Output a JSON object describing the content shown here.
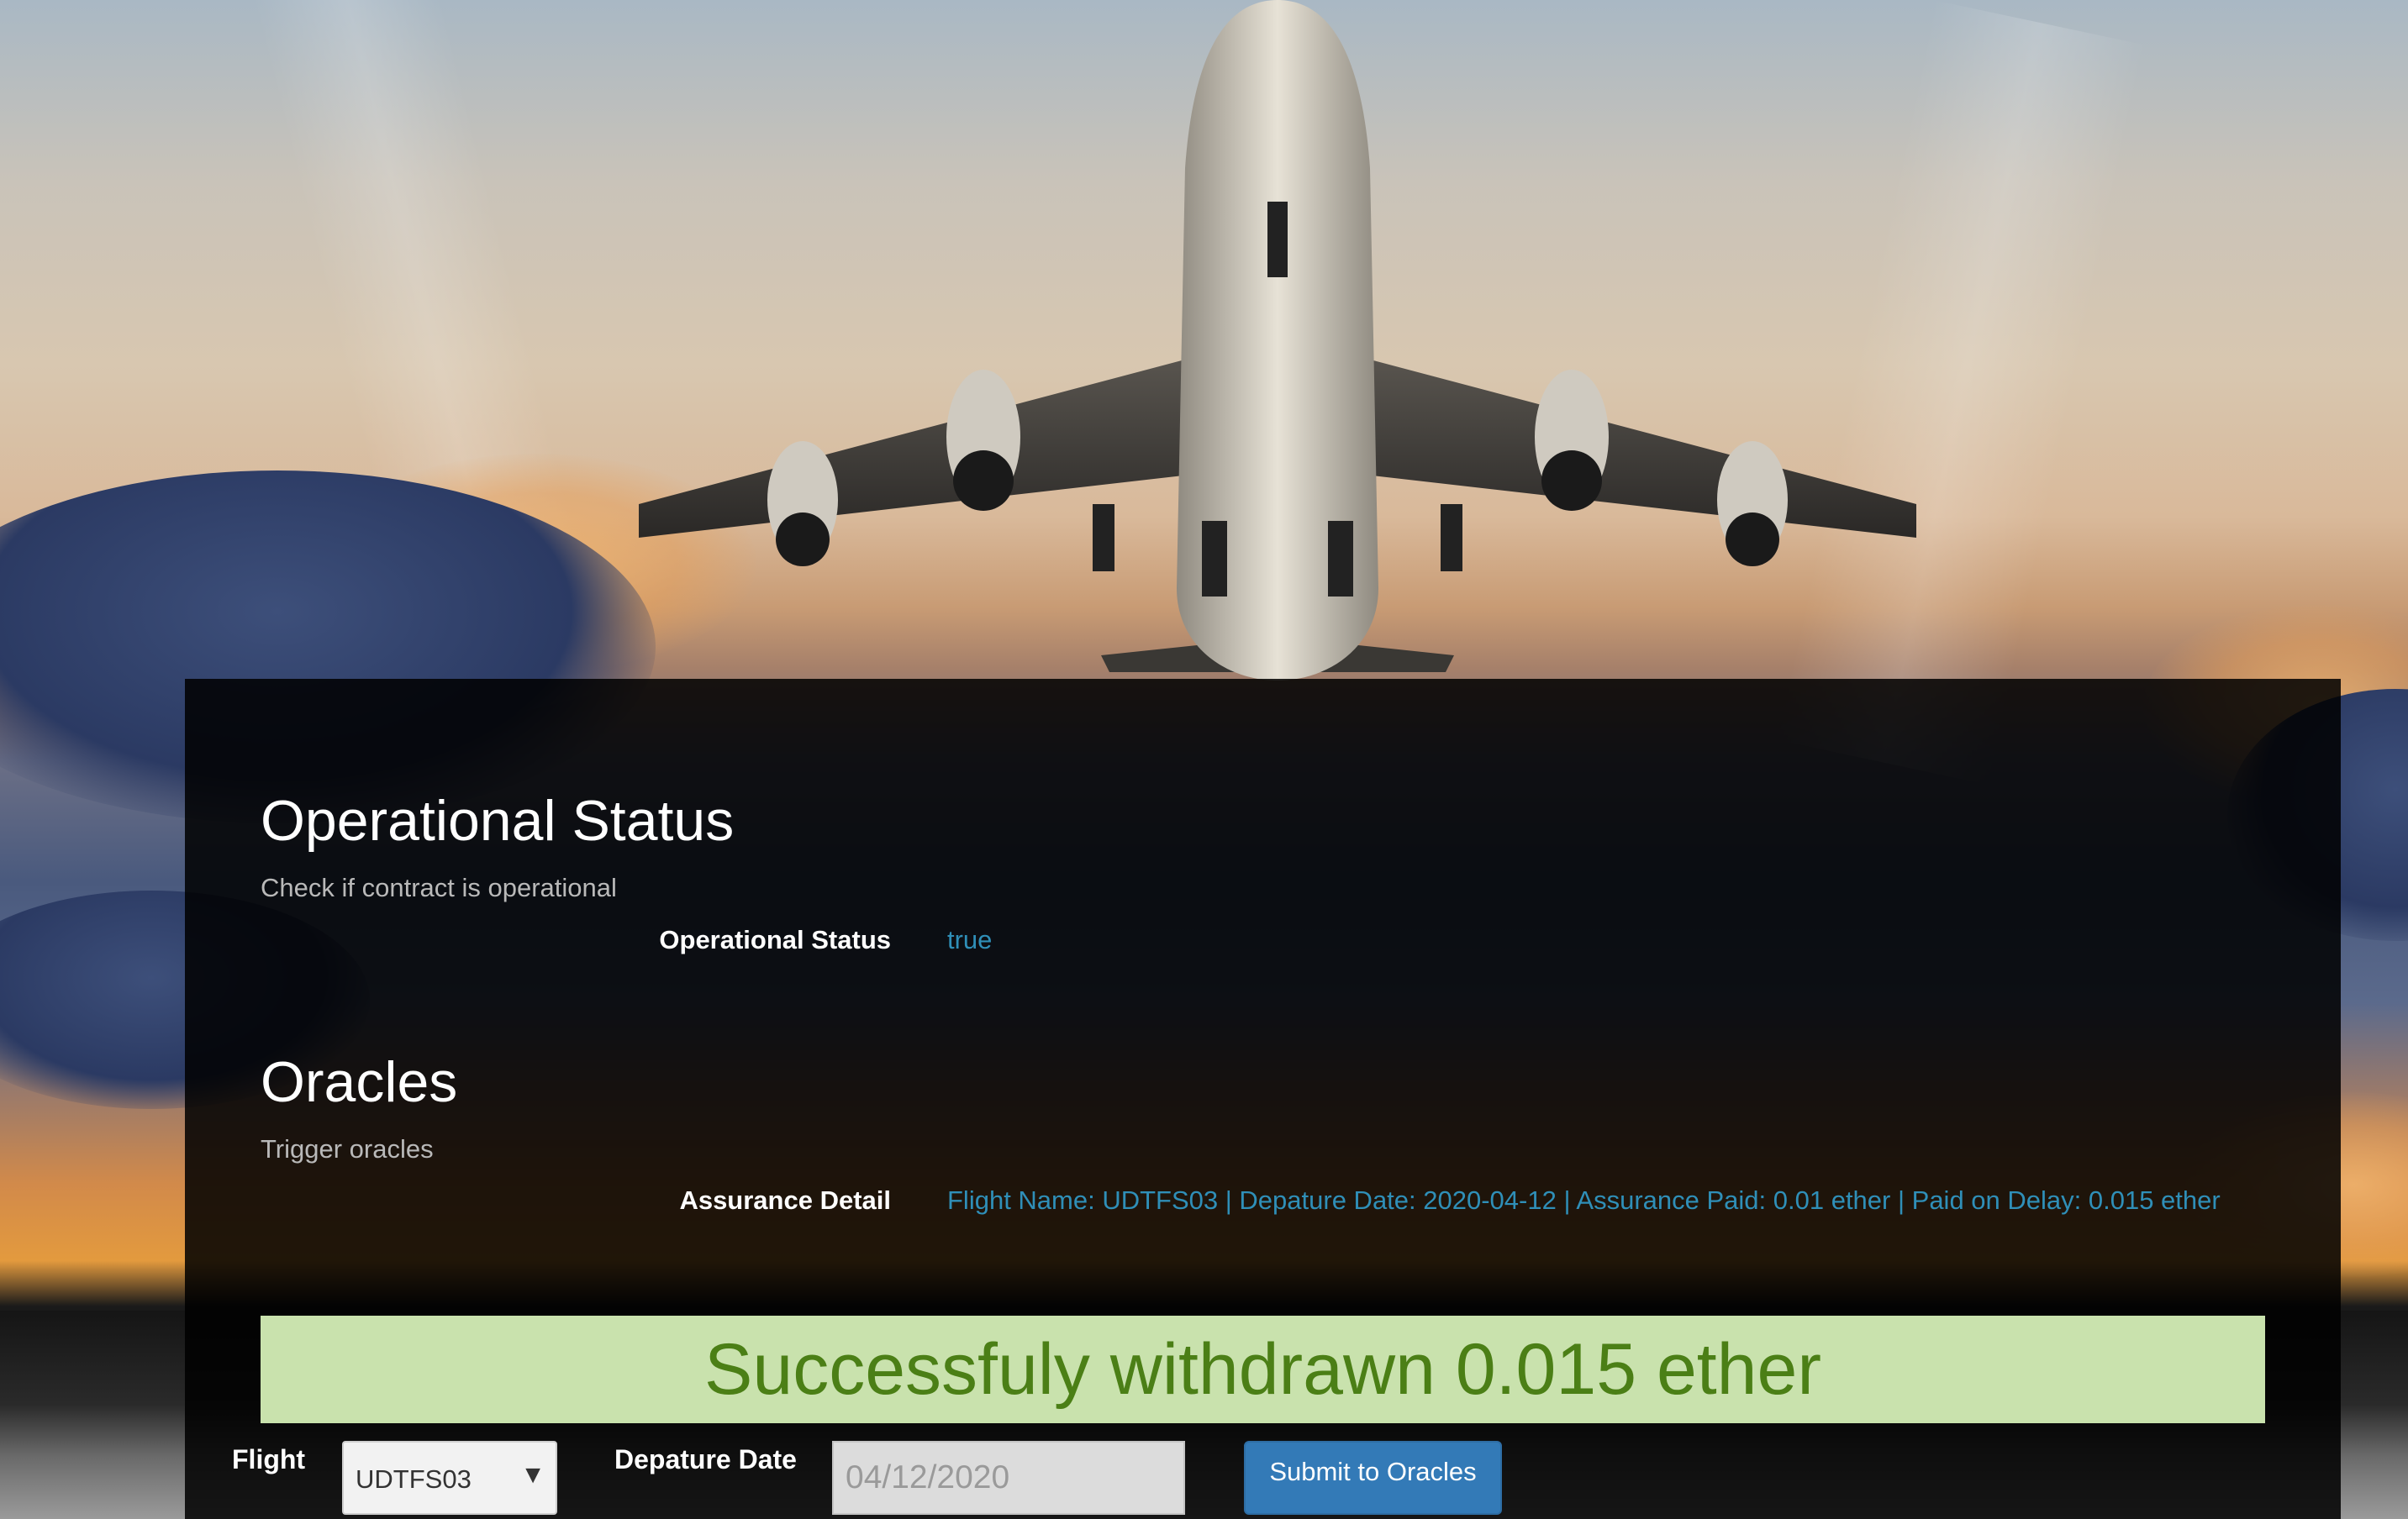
{
  "operational": {
    "title": "Operational Status",
    "subtitle": "Check if contract is operational",
    "label": "Operational Status",
    "value": "true"
  },
  "oracles": {
    "title": "Oracles",
    "subtitle": "Trigger oracles",
    "label": "Assurance Detail",
    "value": "Flight Name: UDTFS03 | Depature Date: 2020-04-12 | Assurance Paid: 0.01 ether | Paid on Delay: 0.015 ether"
  },
  "banner": {
    "message": "Successfuly withdrawn 0.015 ether"
  },
  "form": {
    "flight_label": "Flight",
    "flight_value": "UDTFS03",
    "date_label": "Depature Date",
    "date_value": "04/12/2020",
    "submit_label": "Submit to Oracles"
  },
  "colors": {
    "value_text": "#2f8fb8",
    "success_bg": "#c9e2ad",
    "success_text": "#4b7f16",
    "button_bg": "#337ab7"
  },
  "background": {
    "description_icon": "airplane-background-icon"
  }
}
